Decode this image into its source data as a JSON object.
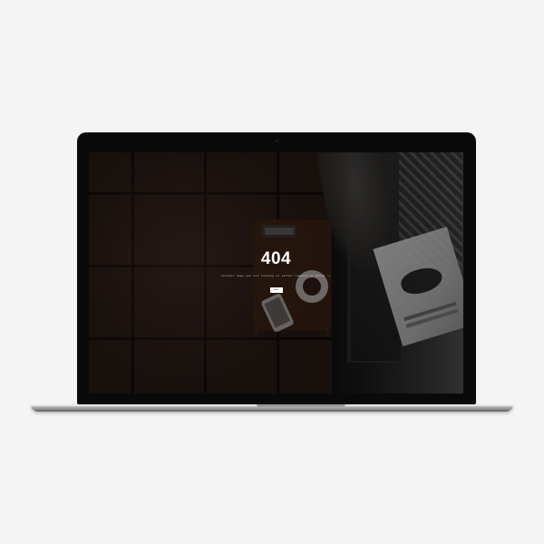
{
  "error_page": {
    "code": "404",
    "message": "onlyfor page you are looking is either removed or moved :)",
    "button_label": "home"
  },
  "colors": {
    "background": "#f4f4f4",
    "screen_overlay": "#241b17",
    "text": "#ffffff",
    "button": "#ffffff"
  },
  "icons": {
    "laptop": "laptop-icon",
    "camera": "camera-icon",
    "coffee_cup": "coffee-cup-icon",
    "phone": "phone-icon",
    "magazine": "magazine-icon"
  }
}
